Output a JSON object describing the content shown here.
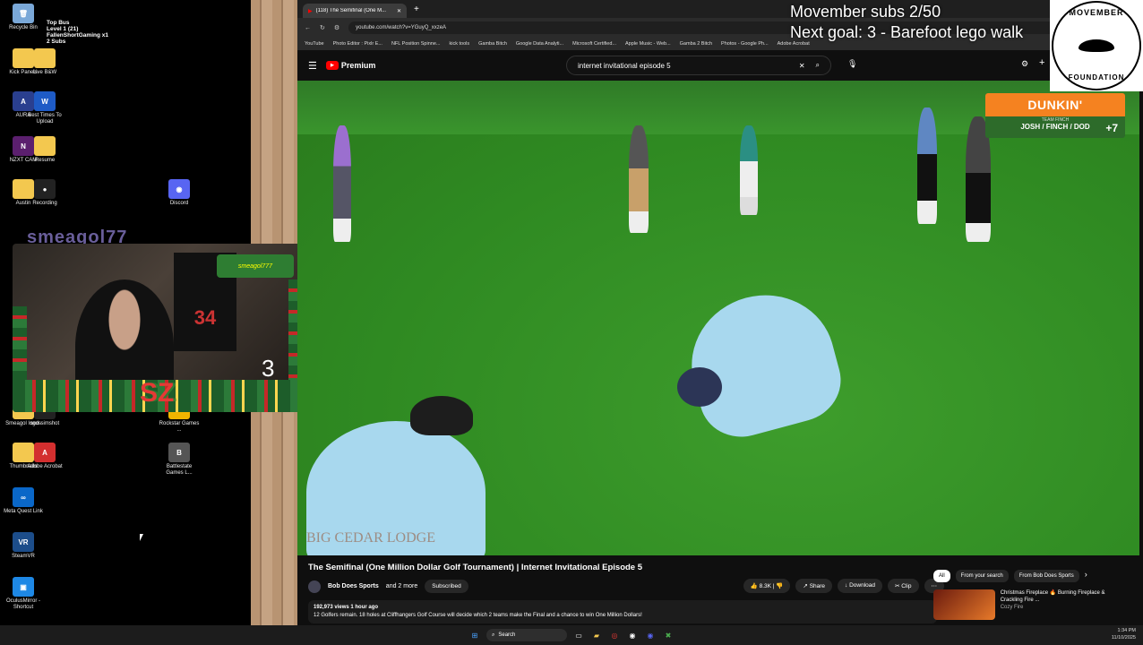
{
  "desktop": {
    "icons": [
      {
        "label": "Recycle Bin",
        "color": "#7aa8d8",
        "glyph": "🗑"
      },
      {
        "label": "Kick Panels",
        "color": "#f3c84f",
        "glyph": ""
      },
      {
        "label": "Live B&W",
        "color": "#f3c84f",
        "glyph": ""
      },
      {
        "label": "AURA",
        "color": "#2a3f8f",
        "glyph": "A"
      },
      {
        "label": "Best Times To Upload",
        "color": "#1e5bc6",
        "glyph": "W"
      },
      {
        "label": "NZXT CAM",
        "color": "#5b1f6e",
        "glyph": "N"
      },
      {
        "label": "Resume",
        "color": "#f3c84f",
        "glyph": ""
      },
      {
        "label": "Austin",
        "color": "#f3c84f",
        "glyph": ""
      },
      {
        "label": "Recording",
        "color": "#222",
        "glyph": "●"
      },
      {
        "label": "Discord",
        "color": "#5865f2",
        "glyph": "◉"
      },
      {
        "label": "Smeagol logos",
        "color": "#f3c84f",
        "glyph": ""
      },
      {
        "label": "snd-simshot",
        "color": "#222",
        "glyph": "●"
      },
      {
        "label": "Rockstar Games ...",
        "color": "#f0b400",
        "glyph": "R"
      },
      {
        "label": "Thumbnails",
        "color": "#f3c84f",
        "glyph": ""
      },
      {
        "label": "Adobe Acrobat",
        "color": "#d32f2f",
        "glyph": "A"
      },
      {
        "label": "Battlestate Games L...",
        "color": "#555",
        "glyph": "B"
      },
      {
        "label": "Meta Quest Link",
        "color": "#0a67c8",
        "glyph": "∞"
      },
      {
        "label": "SteamVR",
        "color": "#1c4d8a",
        "glyph": "VR"
      },
      {
        "label": "OculusMirror - Shortcut",
        "color": "#1e88e5",
        "glyph": "▣"
      }
    ],
    "alert": {
      "title": "Top Bus",
      "line1": "Level 1 (21)",
      "line2": "FallenShortGaming x1",
      "line3": "2 Subs"
    },
    "stream_tag": "smeagol77",
    "cam_counter": "3",
    "cam_jersey": "34",
    "cam_sign": "smeagol777"
  },
  "browser": {
    "tab_title": "(118) The Semifinal (One M...",
    "url": "youtube.com/watch?v=YGuyQ_xxzeA",
    "bookmarks": [
      "YouTube",
      "Photo Editor : Pixlr E...",
      "NFL Position Spinne...",
      "kick tools",
      "Gamba Bitch",
      "Google Data Analyti...",
      "Microsoft Certified...",
      "Apple Music - Web...",
      "Gamba 2 Bitch",
      "Photos - Google Ph...",
      "Adobe Acrobat"
    ],
    "brand": "Premium",
    "search_query": "internet invitational episode 5"
  },
  "video": {
    "sponsor": "DUNKIN'",
    "team_label": "TEAM FINCH",
    "team_names": "JOSH / FINCH / DOD",
    "team_score": "+7",
    "watermark": "BIG CEDAR LODGE",
    "title": "The Semifinal (One Million Dollar Golf Tournament) | Internet Invitational Episode 5",
    "channel": "Bob Does Sports",
    "channel_suffix": "and 2 more",
    "subscribed": "Subscribed",
    "likes": "8.3K",
    "share": "Share",
    "download": "Download",
    "clip": "Clip",
    "views_line": "192,973 views  1 hour ago",
    "description": "12 Golfers remain. 18 holes at Cliffhangers Golf Course will decide which 2 teams make the Final and a chance to win One Million Dollars!"
  },
  "sidebar": {
    "chips": [
      "All",
      "From your search",
      "From Bob Does Sports"
    ],
    "rec_title": "Christmas Fireplace 🔥 Burning Fireplace & Crackling Fire ...",
    "rec_channel": "Cozy Fire"
  },
  "overlay": {
    "line1": "Movember subs 2/50",
    "line2": "Next goal: 3 - Barefoot lego walk",
    "badge_top": "MOVEMBER",
    "badge_bottom": "FOUNDATION"
  },
  "taskbar": {
    "search_label": "Search",
    "time": "1:34 PM",
    "date": "11/10/2025"
  }
}
